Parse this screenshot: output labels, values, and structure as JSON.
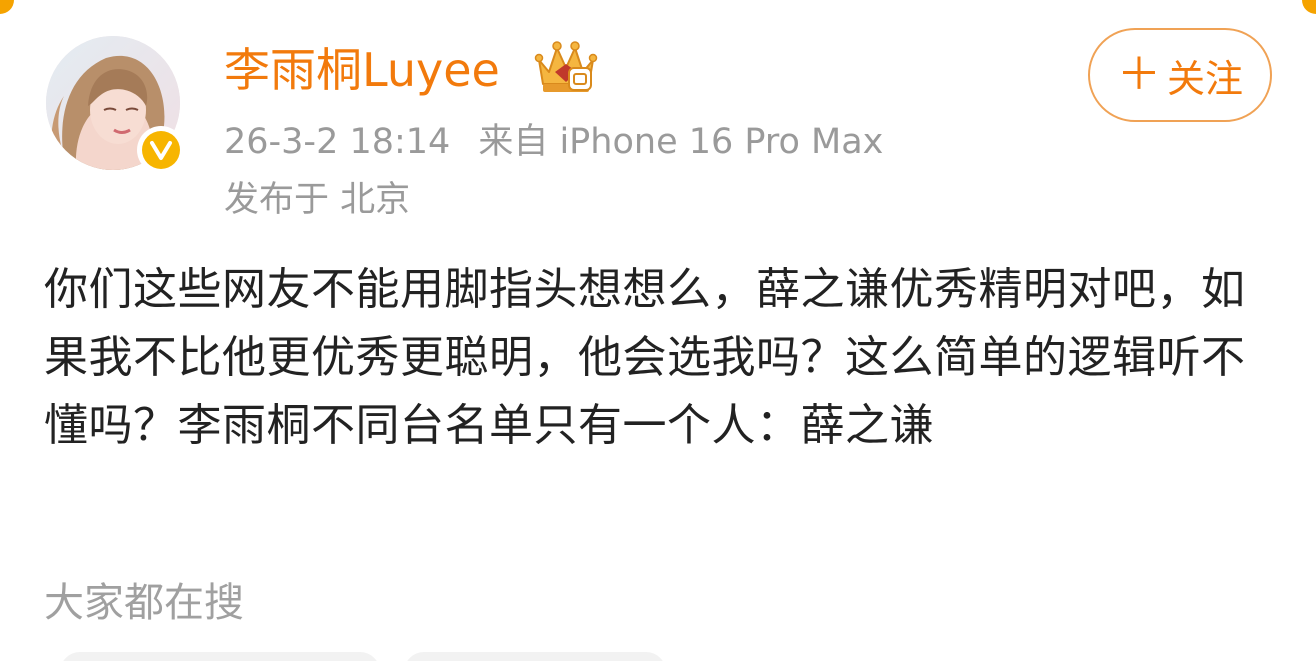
{
  "post": {
    "author": {
      "name": "李雨桐Luyee",
      "avatar_icon": "avatar-portrait",
      "verified_icon": "verified-v-badge",
      "membership_icon": "crown-badge-icon"
    },
    "timestamp": "26-3-2 18:14",
    "source": "来自 iPhone 16 Pro Max",
    "location": "发布于 北京",
    "follow_label": "关注",
    "follow_icon": "plus-icon",
    "text": "你们这些网友不能用脚指头想想么，薛之谦优秀精明对吧，如果我不比他更优秀更聪明，他会选我吗？这么简单的逻辑听不懂吗？李雨桐不同台名单只有一个人：薛之谦"
  },
  "trending": {
    "label": "大家都在搜"
  },
  "colors": {
    "accent": "#f27a0c",
    "follow_border": "#f0a255",
    "meta_text": "#9a9a9a",
    "body_text": "#222222",
    "verified": "#f7b500"
  }
}
